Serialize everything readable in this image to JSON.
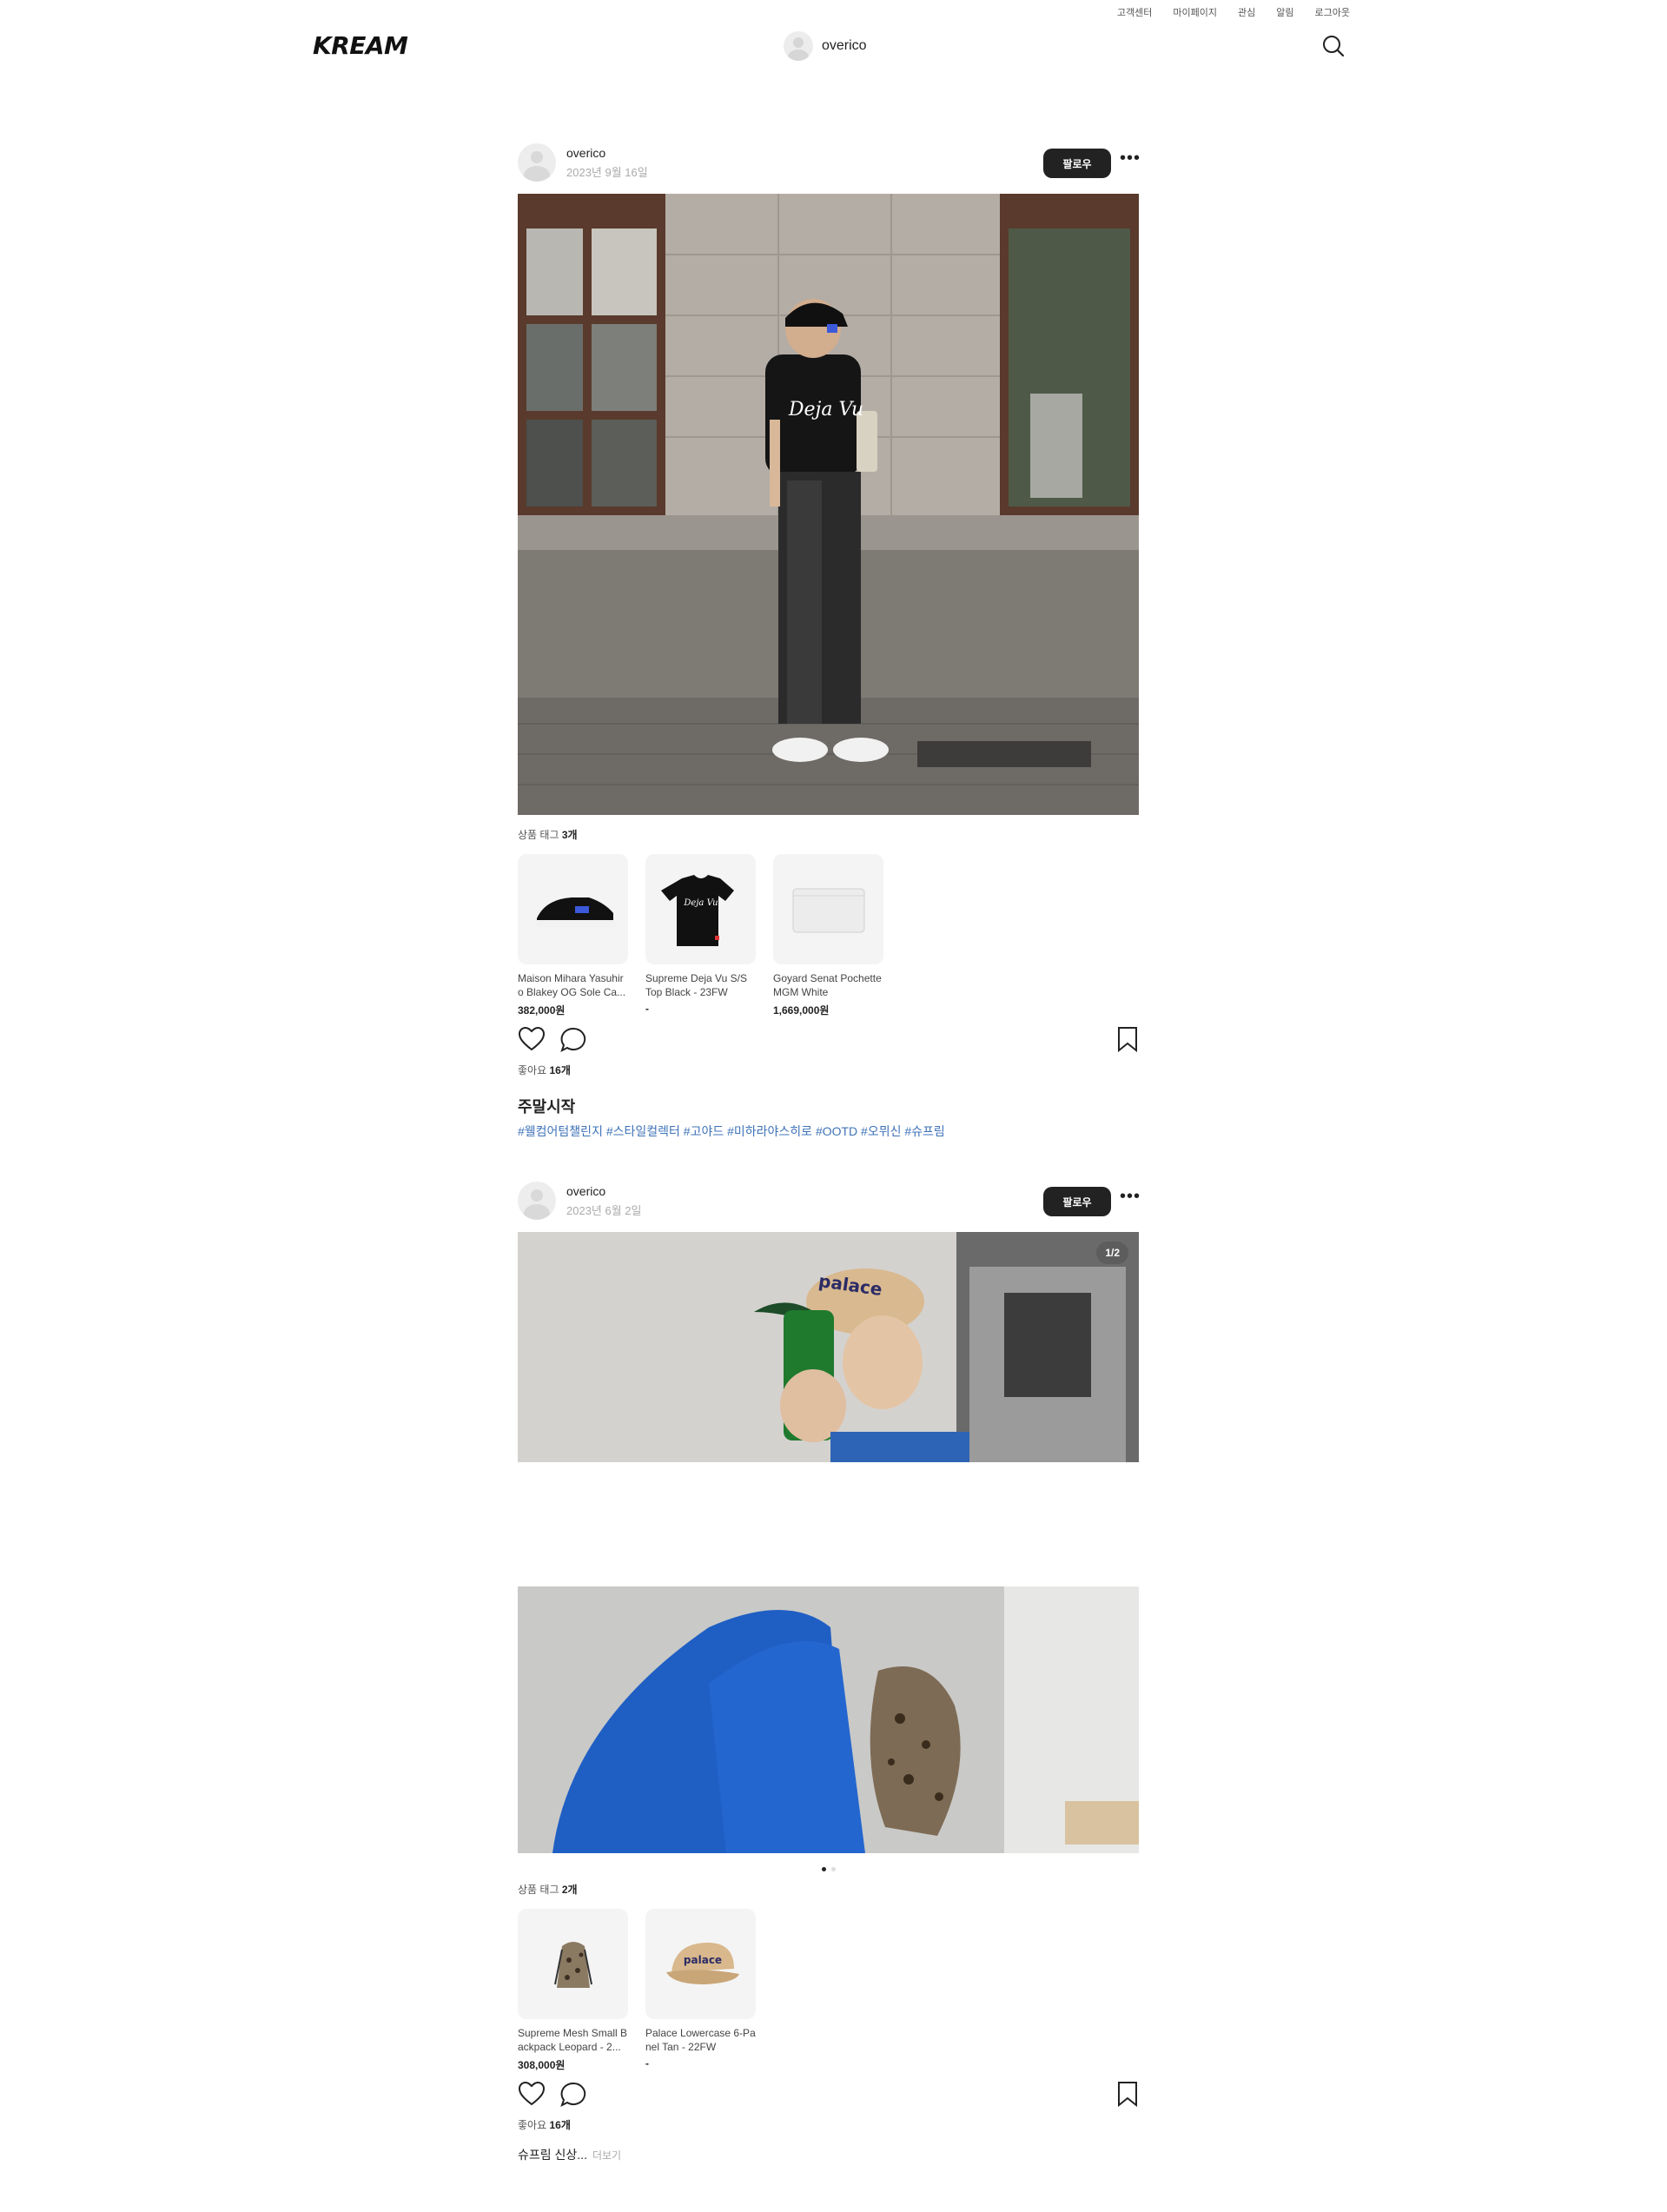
{
  "util_nav": [
    "고객센터",
    "마이페이지",
    "관심",
    "알림",
    "로그아웃"
  ],
  "header": {
    "logo": "KREAM",
    "username": "overico"
  },
  "posts": [
    {
      "username": "overico",
      "date": "2023년 9월 16일",
      "follow_label": "팔로우",
      "tag_prefix": "상품 태그 ",
      "tag_count": "3개",
      "products": [
        {
          "name": "Maison Mihara Yasuhiro Blakey OG Sole Ca...",
          "price": "382,000원"
        },
        {
          "name": "Supreme Deja Vu S/S Top Black - 23FW",
          "price": "-"
        },
        {
          "name": "Goyard Senat Pochette MGM White",
          "price": "1,669,000원"
        }
      ],
      "likes_prefix": "좋아요 ",
      "likes_count": "16개",
      "caption_title": "주말시작",
      "hashtags": "#웰컴어텀챌린지 #스타일컬렉터 #고야드 #미하라야스히로 #OOTD #오뮈신 #슈프림",
      "shirt_text": "Deja Vu"
    },
    {
      "username": "overico",
      "date": "2023년 6월 2일",
      "follow_label": "팔로우",
      "page_badge": "1/2",
      "tag_prefix": "상품 태그 ",
      "tag_count": "2개",
      "products": [
        {
          "name": "Supreme Mesh Small Backpack Leopard - 2...",
          "price": "308,000원"
        },
        {
          "name": "Palace Lowercase 6-Panel Tan - 22FW",
          "price": "-"
        }
      ],
      "likes_prefix": "좋아요 ",
      "likes_count": "16개",
      "caption": "슈프림 신상...",
      "more_label": "더보기",
      "cap_text": "palace"
    }
  ],
  "colors": {
    "hashtag": "#3f73b8",
    "follow_bg": "#222222",
    "product_bg": "#f4f4f4"
  }
}
